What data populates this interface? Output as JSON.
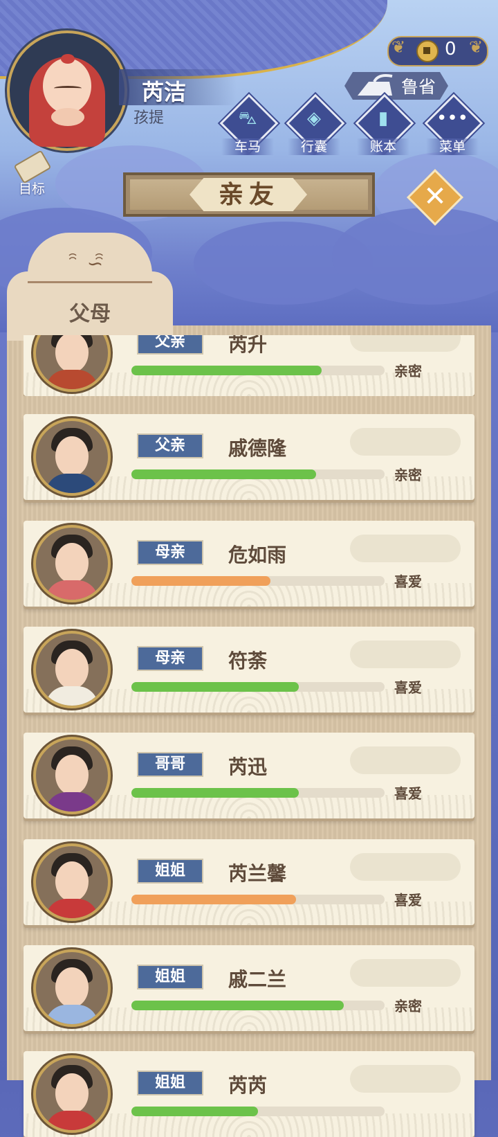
{
  "player": {
    "name": "芮洁",
    "title": "孩提"
  },
  "currency": {
    "amount": "0"
  },
  "region": {
    "label": "鲁省"
  },
  "nav": [
    {
      "label": "车马",
      "icon": "carriage-icon"
    },
    {
      "label": "行囊",
      "icon": "bag-icon"
    },
    {
      "label": "账本",
      "icon": "ledger-icon"
    },
    {
      "label": "菜单",
      "icon": "menu-icon"
    }
  ],
  "goal": {
    "label": "目标"
  },
  "page": {
    "title": "亲友"
  },
  "tabs": [
    {
      "label": "父母",
      "active": true
    }
  ],
  "colors": {
    "green": "#6cc24a",
    "orange": "#f0a05a",
    "tag": "#4d6a9a"
  },
  "relatives": [
    {
      "relation": "父亲",
      "name": "芮升",
      "affinity": 0.75,
      "level": "亲密",
      "bar_color": "#6cc24a",
      "robe": "#b84a30"
    },
    {
      "relation": "父亲",
      "name": "戚德隆",
      "affinity": 0.73,
      "level": "亲密",
      "bar_color": "#6cc24a",
      "robe": "#2c4a7a"
    },
    {
      "relation": "母亲",
      "name": "危如雨",
      "affinity": 0.55,
      "level": "喜爱",
      "bar_color": "#f0a05a",
      "robe": "#d86a6a"
    },
    {
      "relation": "母亲",
      "name": "符荼",
      "affinity": 0.66,
      "level": "喜爱",
      "bar_color": "#6cc24a",
      "robe": "#f1ece0"
    },
    {
      "relation": "哥哥",
      "name": "芮迅",
      "affinity": 0.66,
      "level": "喜爱",
      "bar_color": "#6cc24a",
      "robe": "#7a3a8a"
    },
    {
      "relation": "姐姐",
      "name": "芮兰馨",
      "affinity": 0.65,
      "level": "喜爱",
      "bar_color": "#f0a05a",
      "robe": "#c83a3a"
    },
    {
      "relation": "姐姐",
      "name": "戚二兰",
      "affinity": 0.84,
      "level": "亲密",
      "bar_color": "#6cc24a",
      "robe": "#9ab6e0"
    },
    {
      "relation": "姐姐",
      "name": "芮芮",
      "affinity": 0.5,
      "level": "",
      "bar_color": "#6cc24a",
      "robe": "#c83a3a"
    }
  ]
}
